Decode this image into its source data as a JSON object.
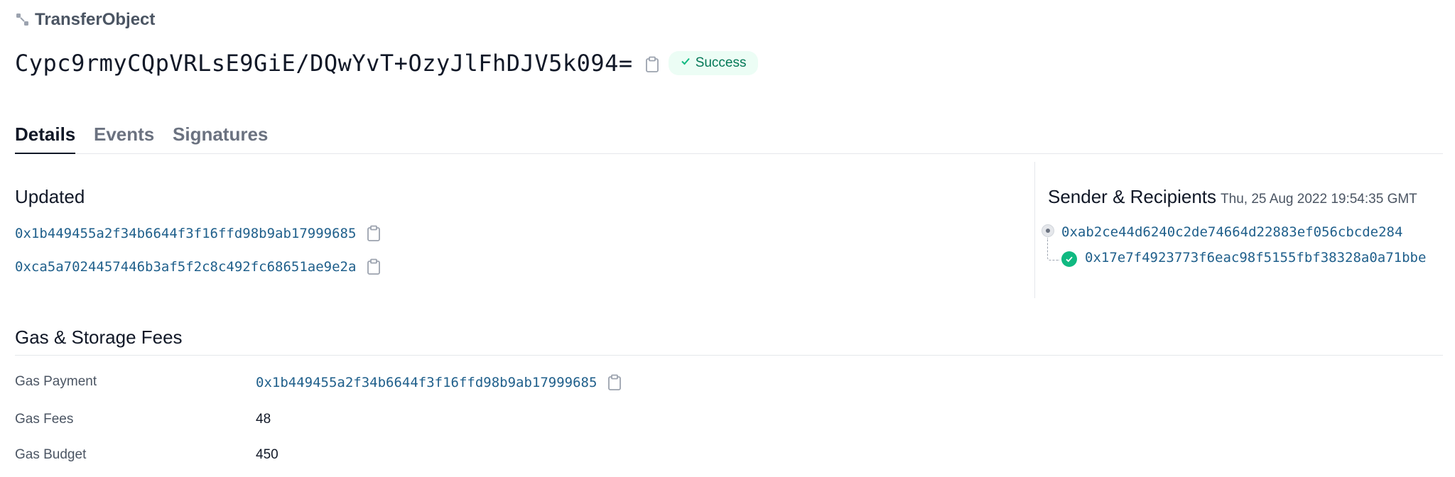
{
  "header": {
    "tx_type": "TransferObject",
    "digest": "Cypc9rmyCQpVRLsE9GiE/DQwYvT+OzyJlFhDJV5k094=",
    "status": "Success"
  },
  "tabs": [
    {
      "label": "Details",
      "active": true
    },
    {
      "label": "Events",
      "active": false
    },
    {
      "label": "Signatures",
      "active": false
    }
  ],
  "updated": {
    "title": "Updated",
    "objects": [
      "0x1b449455a2f34b6644f3f16ffd98b9ab17999685",
      "0xca5a7024457446b3af5f2c8c492fc68651ae9e2a"
    ]
  },
  "sender_recipients": {
    "title": "Sender & Recipients",
    "date": "Thu, 25 Aug 2022 19:54:35 GMT",
    "sender": "0xab2ce44d6240c2de74664d22883ef056cbcde284",
    "recipient": "0x17e7f4923773f6eac98f5155fbf38328a0a71bbe"
  },
  "gas": {
    "title": "Gas & Storage Fees",
    "payment_label": "Gas Payment",
    "payment_value": "0x1b449455a2f34b6644f3f16ffd98b9ab17999685",
    "fees_label": "Gas Fees",
    "fees_value": "48",
    "budget_label": "Gas Budget",
    "budget_value": "450"
  },
  "colors": {
    "link": "#1f5f8b",
    "success_bg": "#ecfdf5",
    "success_text": "#047857",
    "success_icon": "#10b981"
  },
  "icons": {
    "tx_type": "transfer-object-icon",
    "copy": "clipboard-icon",
    "status": "check-icon",
    "sender": "sender-dot-icon",
    "recipient": "check-circle-icon"
  }
}
